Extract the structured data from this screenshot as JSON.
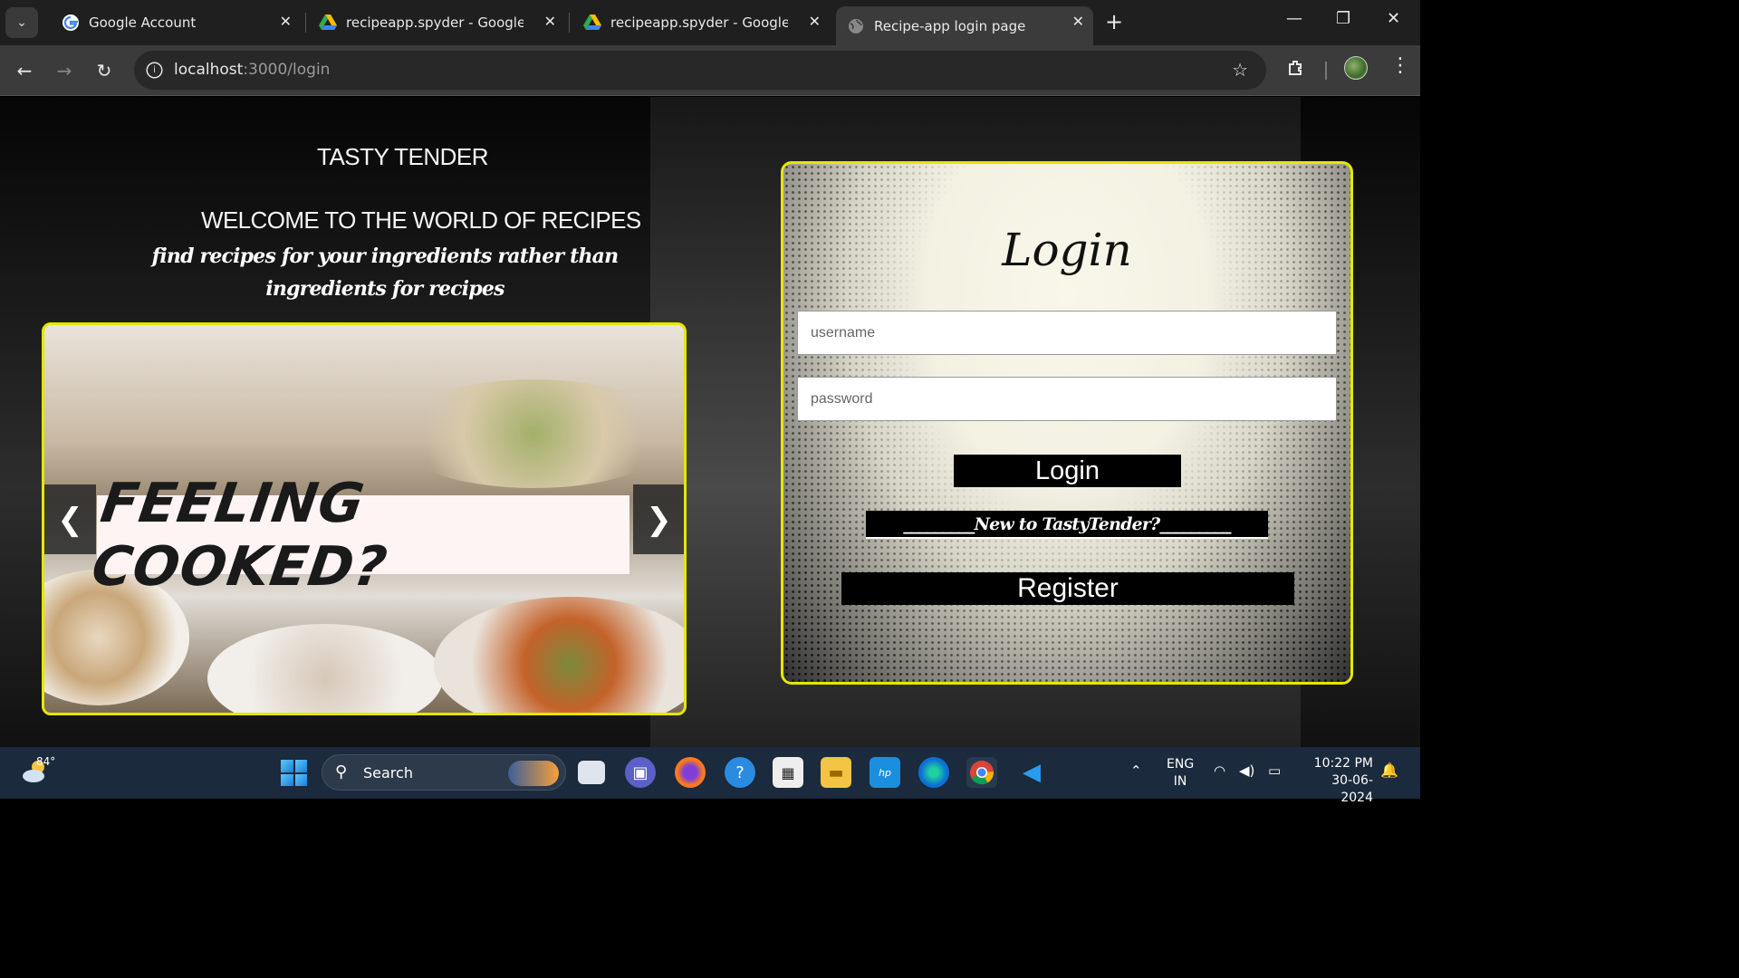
{
  "browser": {
    "tabs": [
      {
        "title": "Google Account",
        "favicon": "google-g-icon",
        "active": false
      },
      {
        "title": "recipeapp.spyder - Google Drive",
        "favicon": "google-drive-icon",
        "active": false
      },
      {
        "title": "recipeapp.spyder - Google Drive",
        "favicon": "google-drive-icon",
        "active": false
      },
      {
        "title": "Recipe-app login page",
        "favicon": "globe-icon",
        "active": true
      }
    ],
    "new_tab_glyph": "+",
    "url_host": "localhost",
    "url_rest": ":3000/login"
  },
  "page": {
    "brand": "TASTY TENDER",
    "welcome": "WELCOME TO THE WORLD OF RECIPES",
    "tagline": "find recipes for your ingredients rather than ingredients for recipes",
    "carousel": {
      "banner_text": "FEELING COOKED?",
      "prev_glyph": "❮",
      "next_glyph": "❯"
    },
    "login": {
      "title": "Login",
      "username_placeholder": "username",
      "password_placeholder": "password",
      "login_button": "Login",
      "new_user_text": "_________New to TastyTender?_________",
      "register_button": "Register"
    },
    "accent_color": "#e6e600"
  },
  "taskbar": {
    "weather_temp": "84°",
    "search_label": "Search",
    "lang_line1": "ENG",
    "lang_line2": "IN",
    "time": "10:22 PM",
    "date": "30-06-2024"
  }
}
